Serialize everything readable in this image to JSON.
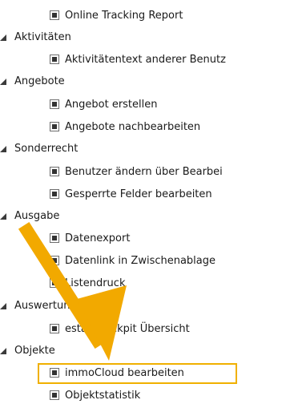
{
  "accent_color": "#f0b000",
  "arrow_color": "#f2a900",
  "tree": {
    "leaf_online_tracking": "Online Tracking Report",
    "group_aktivitaeten": "Aktivitäten",
    "leaf_aktivitaetentext": "Aktivitätentext anderer Benutz",
    "group_angebote": "Angebote",
    "leaf_angebot_erstellen": "Angebot erstellen",
    "leaf_angebote_nachbearbeiten": "Angebote nachbearbeiten",
    "group_sonderrecht": "Sonderrecht",
    "leaf_benutzer_aendern": "Benutzer ändern über Bearbei",
    "leaf_gesperrte_felder": "Gesperrte Felder bearbeiten",
    "group_ausgabe": "Ausgabe",
    "leaf_datenexport": "Datenexport",
    "leaf_datenlink": "Datenlink in Zwischenablage",
    "leaf_listendruck": "Listendruck",
    "group_auswertung": "Auswertung",
    "leaf_cockpit": "estateCockpit Übersicht",
    "group_objekte": "Objekte",
    "leaf_immocloud": "immoCloud bearbeiten",
    "leaf_objektstatistik": "Objektstatistik"
  }
}
